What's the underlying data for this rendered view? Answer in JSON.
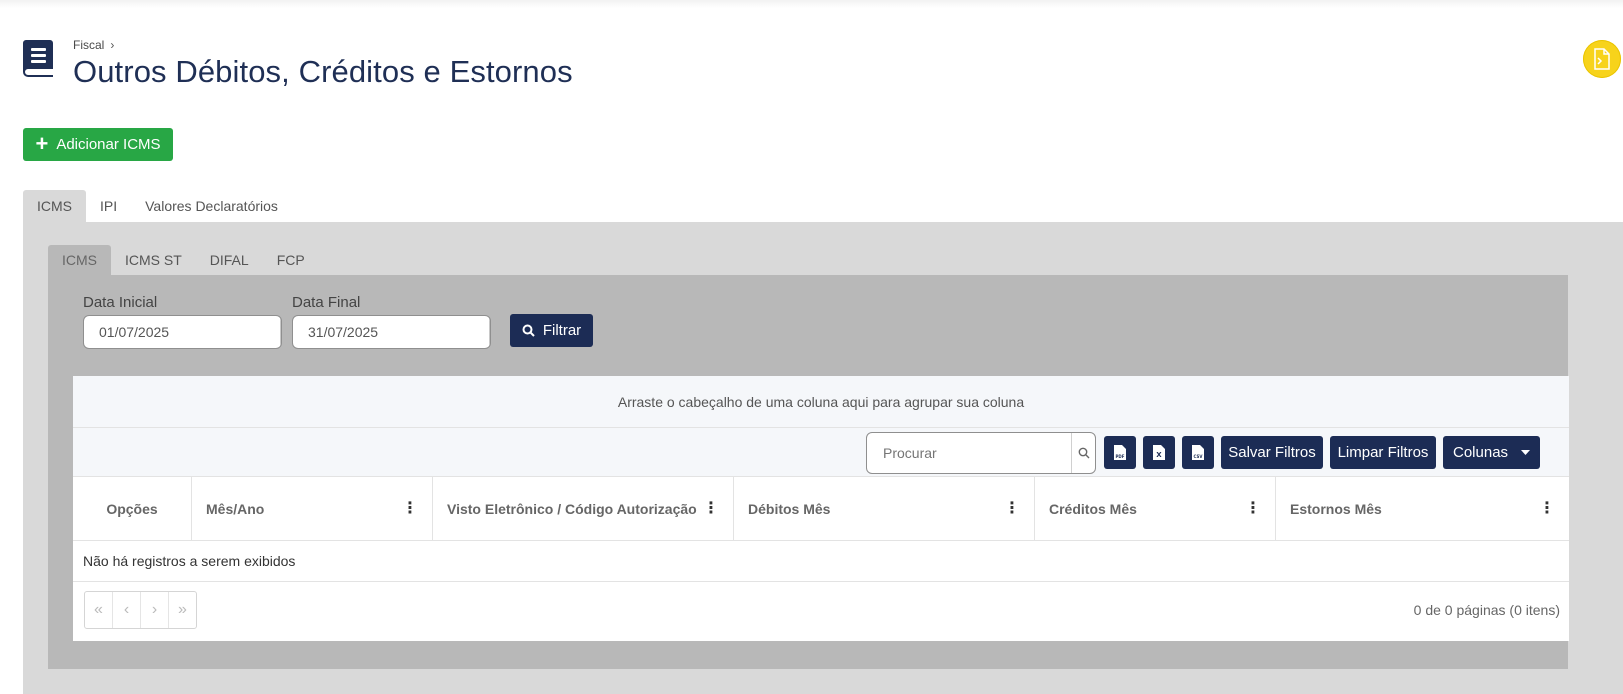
{
  "breadcrumb": {
    "parent": "Fiscal",
    "separator": "›"
  },
  "page": {
    "title": "Outros Débitos, Créditos e Estornos"
  },
  "actions": {
    "add_label": "Adicionar ICMS"
  },
  "tabs_main": [
    "ICMS",
    "IPI",
    "Valores Declaratórios"
  ],
  "tabs_sub": [
    "ICMS",
    "ICMS ST",
    "DIFAL",
    "FCP"
  ],
  "filters": {
    "start_label": "Data Inicial",
    "start_value": "01/07/2025",
    "end_label": "Data Final",
    "end_value": "31/07/2025",
    "filter_label": "Filtrar"
  },
  "grid": {
    "group_hint": "Arraste o cabeçalho de uma coluna aqui para agrupar sua coluna",
    "search_placeholder": "Procurar",
    "save_filters": "Salvar Filtros",
    "clear_filters": "Limpar Filtros",
    "columns_button": "Colunas",
    "export_pdf": "PDF",
    "export_xls": "X",
    "export_csv": "CSV",
    "columns": [
      "Opções",
      "Mês/Ano",
      "Visto Eletrônico / Código Autorização",
      "Débitos Mês",
      "Créditos Mês",
      "Estornos Mês"
    ],
    "empty_message": "Não há registros a serem exibidos",
    "pager_info": "0 de 0 páginas (0 itens)",
    "pager": {
      "first": "«",
      "prev": "‹",
      "next": "›",
      "last": "»"
    }
  },
  "colors": {
    "primary": "#1c2c55",
    "success": "#28a745",
    "help": "#f7d31b"
  }
}
